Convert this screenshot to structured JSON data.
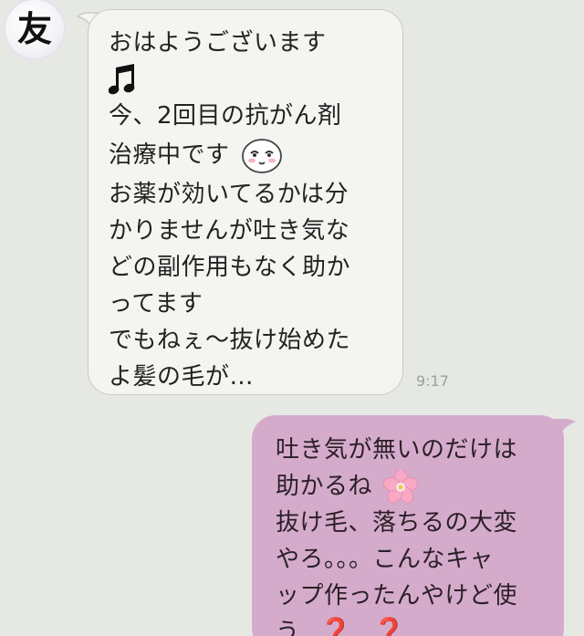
{
  "colors": {
    "background": "#e6e9e3",
    "incoming_bubble": "#f4f5f1",
    "outgoing_bubble": "#d5abcb",
    "timestamp": "#9aa09a",
    "question_mark": "#e0141a"
  },
  "contact": {
    "avatar_text": "友"
  },
  "incoming": {
    "lines": [
      "おはようございます",
      "",
      "今、2回目の抗がん剤",
      "治療中です",
      "お薬が効いてるかは分",
      "かりませんが吐き気な",
      "どの副作用もなく助か",
      "ってます",
      "でもねぇ〜抜け始めた",
      "よ髪の毛が…"
    ],
    "icons": [
      "music-note-icon",
      "smiley-face-icon"
    ],
    "time": "9:17"
  },
  "outgoing": {
    "lines": [
      "吐き気が無いのだけは",
      "助かるね",
      "抜け毛、落ちるの大変",
      "やろ。。。こんなキャ",
      "ップ作ったんやけど使",
      "う"
    ],
    "icons": [
      "cherry-blossom-icon",
      "red-question-mark-icon",
      "red-question-mark-icon"
    ],
    "question_mark": "❓"
  }
}
